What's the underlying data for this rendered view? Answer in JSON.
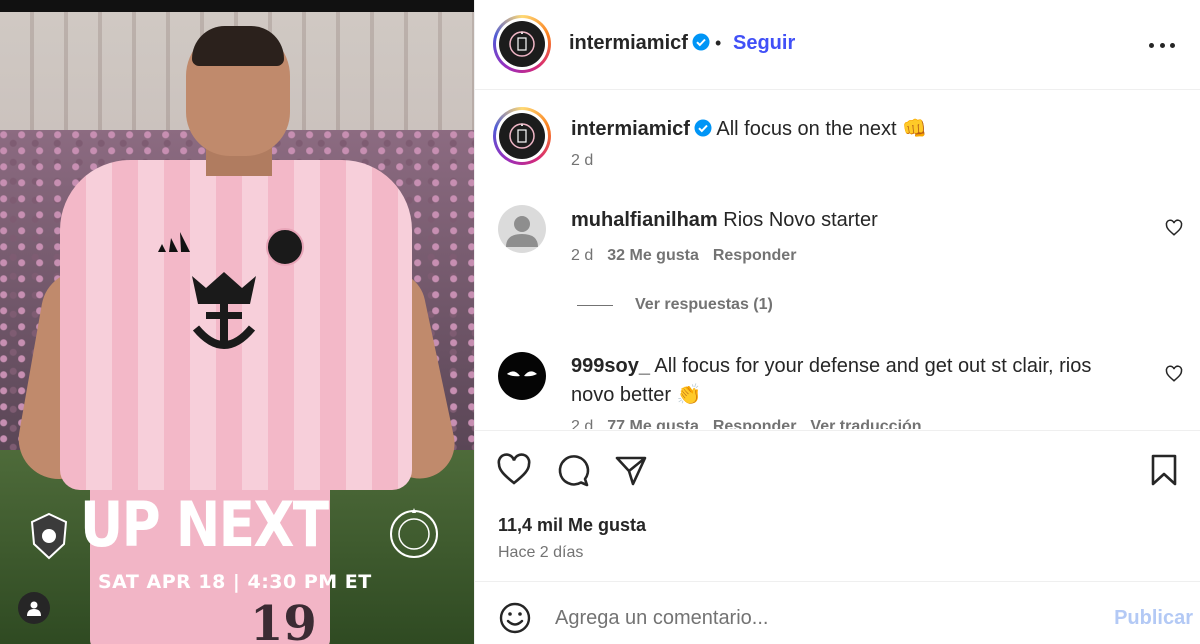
{
  "post": {
    "image": {
      "headline": "UP NEXT",
      "match_info": "SAT APR 18 | 4:30 PM ET",
      "jersey_number": "19",
      "user_tag_icon": "person-icon"
    },
    "header": {
      "username": "intermiamicf",
      "separator": "•",
      "follow_label": "Seguir",
      "verified_icon": "verified-badge-icon",
      "more_icon": "more-options-icon"
    },
    "caption": {
      "username": "intermiamicf",
      "text": "All focus on the next",
      "emoji": "👊",
      "time": "2 d"
    },
    "comments": [
      {
        "username": "muhalfianilham",
        "text": "Rios Novo starter",
        "time": "2 d",
        "likes": "32 Me gusta",
        "reply_label": "Responder",
        "view_replies": "Ver respuestas (1)"
      },
      {
        "username": "999soy_",
        "text_line1": "All focus for your defense and get out st clair, rios",
        "text_line2": "novo better",
        "emoji": "👏",
        "time": "2 d",
        "likes": "77 Me gusta",
        "reply_label": "Responder",
        "translate_label": "Ver traducción"
      }
    ],
    "actions": {
      "like_icon": "heart-icon",
      "comment_icon": "comment-icon",
      "share_icon": "share-icon",
      "save_icon": "bookmark-icon"
    },
    "likes_count": "11,4 mil Me gusta",
    "posted_ago": "Hace 2 días",
    "add_comment": {
      "placeholder": "Agrega un comentario...",
      "publish_label": "Publicar",
      "emoji_icon": "emoji-icon"
    }
  },
  "colors": {
    "accent_blue": "#4150f7",
    "verified_blue": "#0095f6",
    "muted_text": "#737373",
    "publish_disabled": "#b3c9f5"
  }
}
